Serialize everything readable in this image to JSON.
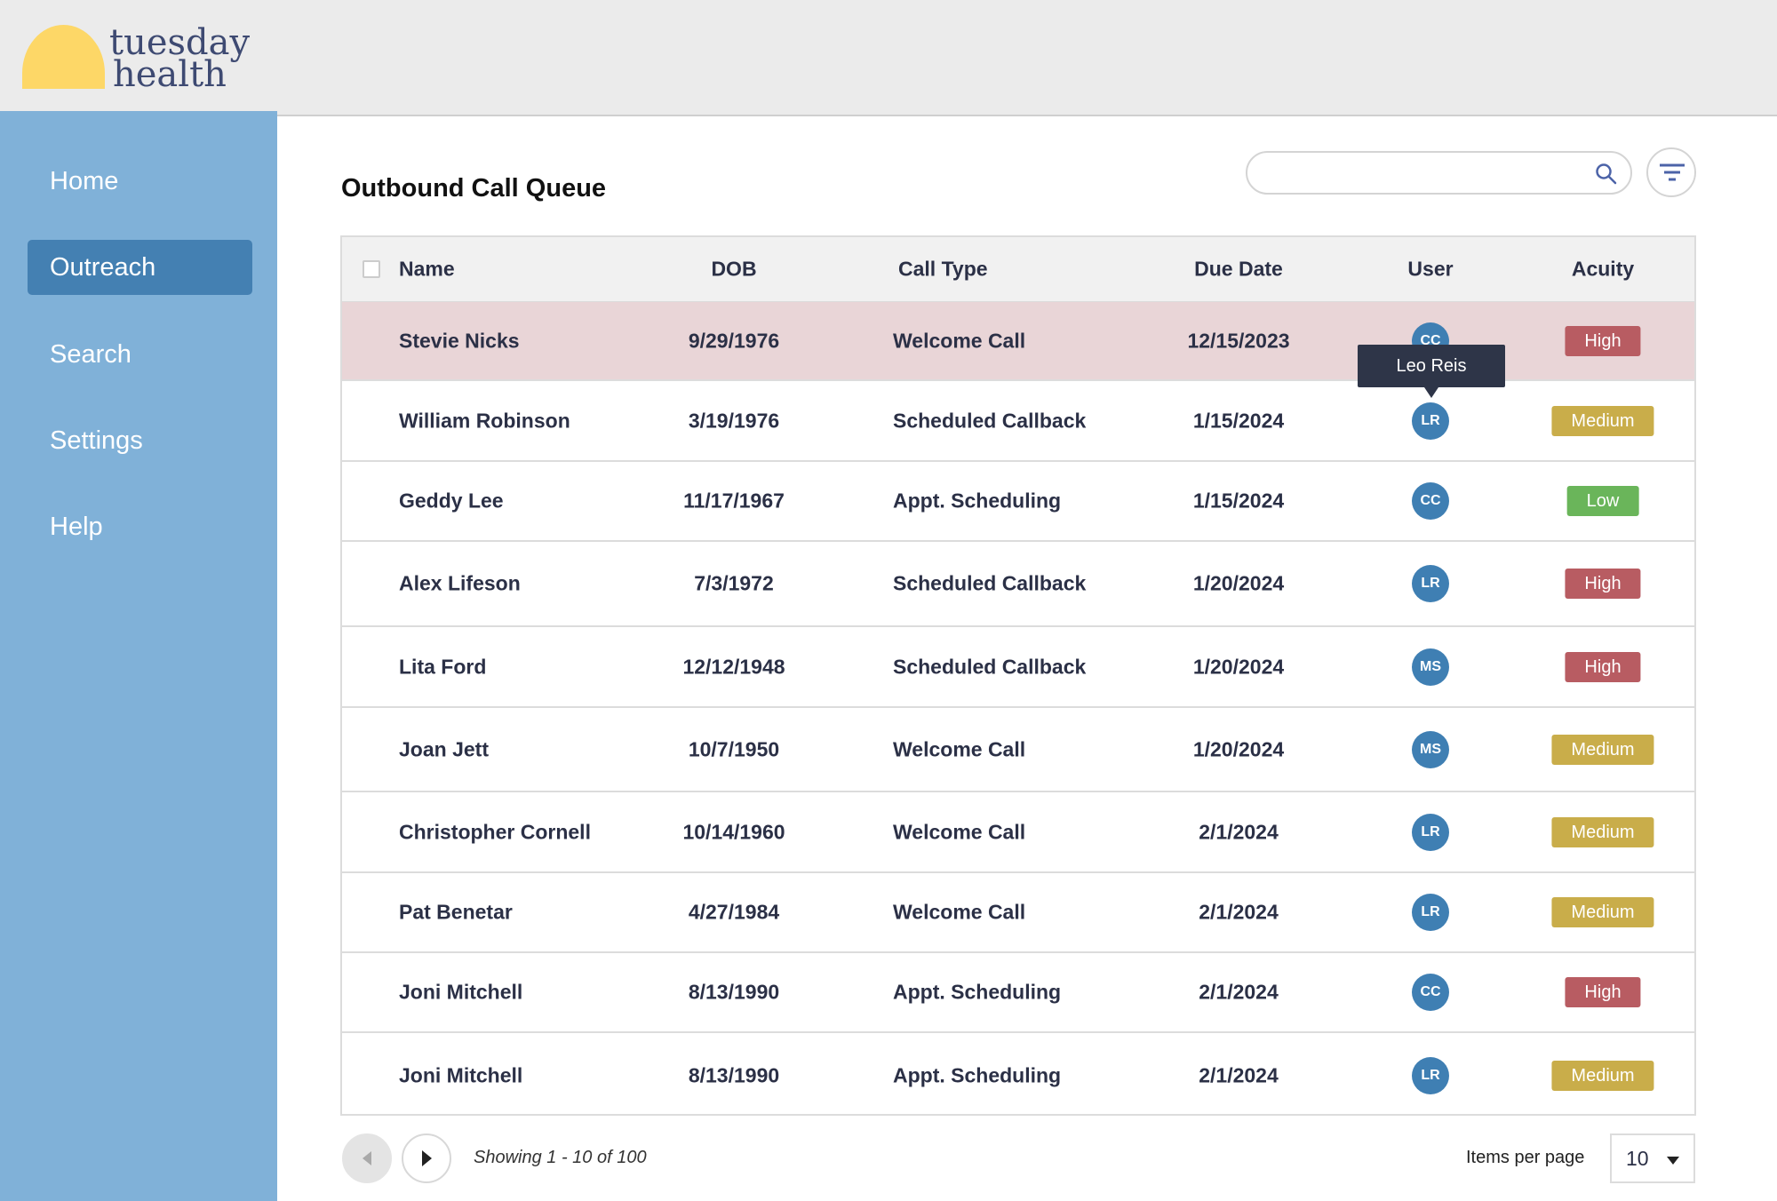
{
  "brand": {
    "line1": "tuesday",
    "line2": "health",
    "sun_color": "#fdd767"
  },
  "sidebar": {
    "items": [
      {
        "label": "Home"
      },
      {
        "label": "Outreach",
        "active": true
      },
      {
        "label": "Search"
      },
      {
        "label": "Settings"
      },
      {
        "label": "Help"
      }
    ]
  },
  "page": {
    "title": "Outbound Call Queue"
  },
  "search": {
    "placeholder": "",
    "value": ""
  },
  "table": {
    "columns": [
      "Name",
      "DOB",
      "Call Type",
      "Due Date",
      "User",
      "Acuity"
    ],
    "rows": [
      {
        "name": "Stevie Nicks",
        "dob": "9/29/1976",
        "type": "Welcome Call",
        "due": "12/15/2023",
        "user": "CC",
        "acuity": "High",
        "highlighted": true
      },
      {
        "name": "William Robinson",
        "dob": "3/19/1976",
        "type": "Scheduled Callback",
        "due": "1/15/2024",
        "user": "LR",
        "acuity": "Medium"
      },
      {
        "name": "Geddy Lee",
        "dob": "11/17/1967",
        "type": "Appt. Scheduling",
        "due": "1/15/2024",
        "user": "CC",
        "acuity": "Low"
      },
      {
        "name": "Alex Lifeson",
        "dob": "7/3/1972",
        "type": "Scheduled Callback",
        "due": "1/20/2024",
        "user": "LR",
        "acuity": "High"
      },
      {
        "name": "Lita Ford",
        "dob": "12/12/1948",
        "type": "Scheduled Callback",
        "due": "1/20/2024",
        "user": "MS",
        "acuity": "High"
      },
      {
        "name": "Joan Jett",
        "dob": "10/7/1950",
        "type": "Welcome Call",
        "due": "1/20/2024",
        "user": "MS",
        "acuity": "Medium"
      },
      {
        "name": "Christopher Cornell",
        "dob": "10/14/1960",
        "type": "Welcome Call",
        "due": "2/1/2024",
        "user": "LR",
        "acuity": "Medium"
      },
      {
        "name": "Pat Benetar",
        "dob": "4/27/1984",
        "type": "Welcome Call",
        "due": "2/1/2024",
        "user": "LR",
        "acuity": "Medium"
      },
      {
        "name": "Joni Mitchell",
        "dob": "8/13/1990",
        "type": "Appt. Scheduling",
        "due": "2/1/2024",
        "user": "CC",
        "acuity": "High"
      },
      {
        "name": "Joni Mitchell",
        "dob": "8/13/1990",
        "type": "Appt. Scheduling",
        "due": "2/1/2024",
        "user": "LR",
        "acuity": "Medium"
      }
    ]
  },
  "tooltip": {
    "text": "Leo Reis"
  },
  "acuity_colors": {
    "High": "#b85c62",
    "Medium": "#c9ad4a",
    "Low": "#6ab55a"
  },
  "pagination": {
    "showing": "Showing 1 - 10 of 100",
    "items_per_page_label": "Items per page",
    "items_per_page": "10"
  }
}
